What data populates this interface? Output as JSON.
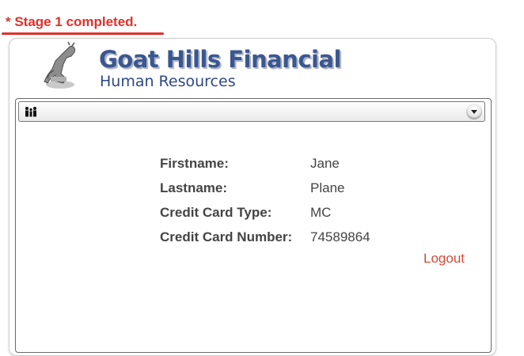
{
  "status": {
    "message": "* Stage 1 completed.",
    "color": "#e0312b"
  },
  "header": {
    "logo_icon": "goat-logo",
    "title": "Goat Hills Financial",
    "subtitle": "Human Resources"
  },
  "toolbar": {
    "icon": "people-icon",
    "dropdown_icon": "chevron-down-icon"
  },
  "profile": {
    "fields": [
      {
        "label": "Firstname:",
        "value": "Jane"
      },
      {
        "label": "Lastname:",
        "value": "Plane"
      },
      {
        "label": "Credit Card Type:",
        "value": "MC"
      },
      {
        "label": "Credit Card Number:",
        "value": "74589864"
      }
    ]
  },
  "actions": {
    "logout_label": "Logout"
  }
}
